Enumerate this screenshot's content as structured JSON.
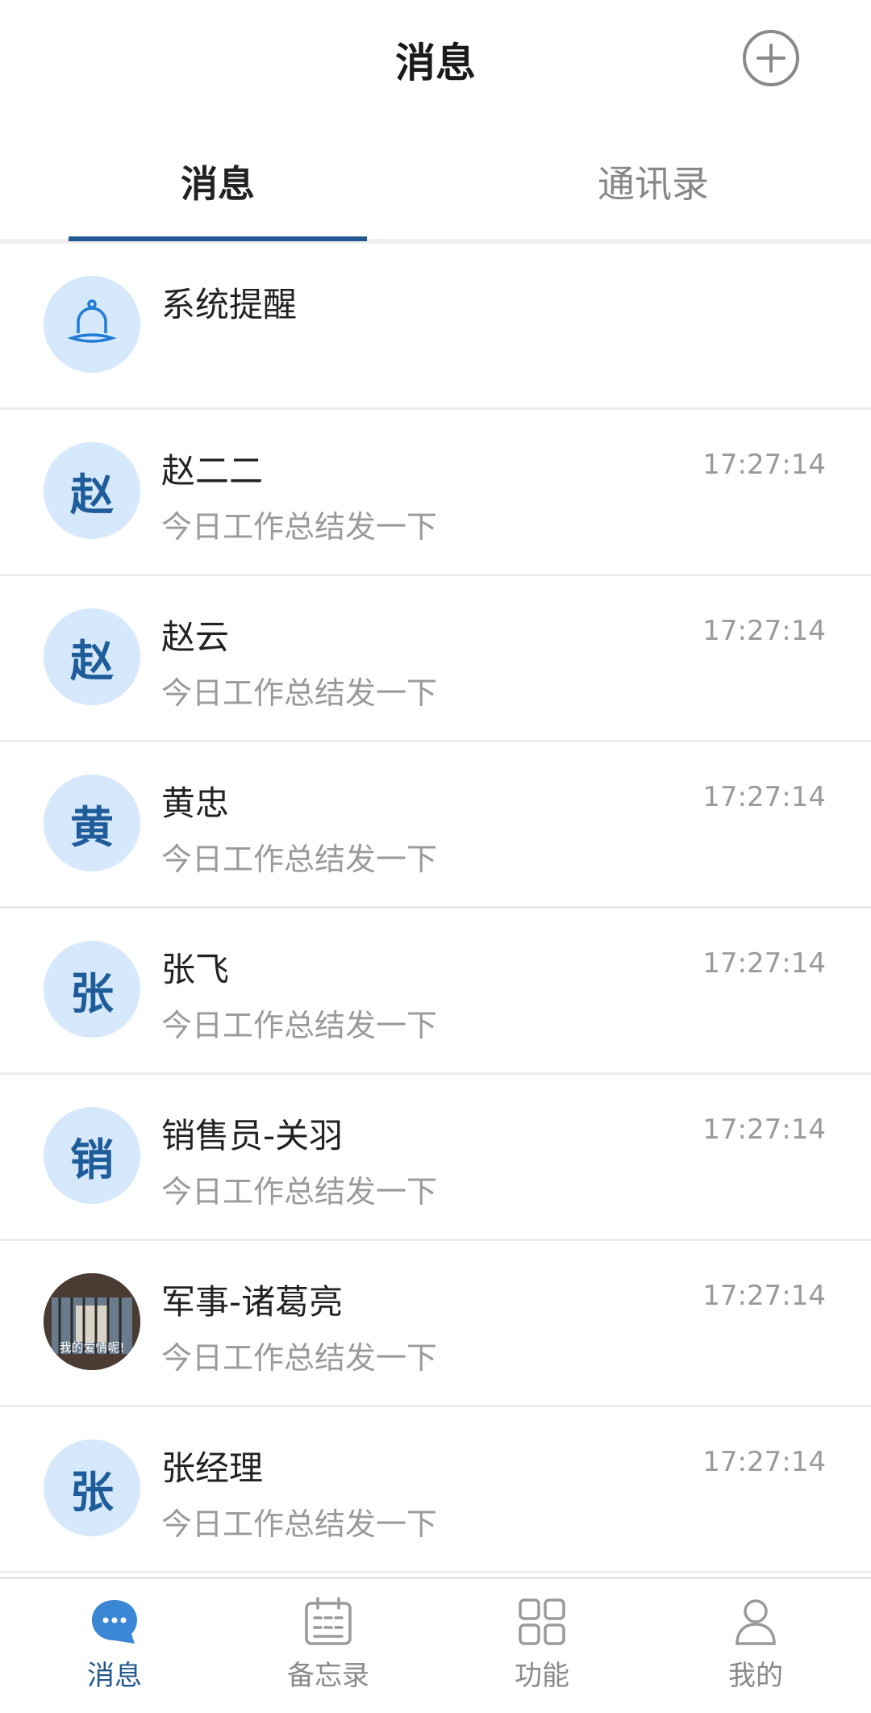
{
  "header": {
    "title": "消息",
    "add_icon": "plus-circle-icon"
  },
  "tabs": [
    {
      "label": "消息",
      "active": true
    },
    {
      "label": "通讯录",
      "active": false
    }
  ],
  "messages": [
    {
      "name": "系统提醒",
      "preview": "",
      "time": "",
      "avatar": "bell-icon"
    },
    {
      "name": "赵二二",
      "preview": "今日工作总结发一下",
      "time": "17:27:14",
      "avatar": "赵"
    },
    {
      "name": "赵云",
      "preview": "今日工作总结发一下",
      "time": "17:27:14",
      "avatar": "赵"
    },
    {
      "name": "黄忠",
      "preview": "今日工作总结发一下",
      "time": "17:27:14",
      "avatar": "黄"
    },
    {
      "name": "张飞",
      "preview": "今日工作总结发一下",
      "time": "17:27:14",
      "avatar": "张"
    },
    {
      "name": "销售员-关羽",
      "preview": "今日工作总结发一下",
      "time": "17:27:14",
      "avatar": "销"
    },
    {
      "name": "军事-诸葛亮",
      "preview": "今日工作总结发一下",
      "time": "17:27:14",
      "avatar": "photo",
      "avatar_caption": "我的爱情呢!"
    },
    {
      "name": "张经理",
      "preview": "今日工作总结发一下",
      "time": "17:27:14",
      "avatar": "张"
    }
  ],
  "bottom_nav": [
    {
      "label": "消息",
      "icon": "chat-bubble-icon",
      "active": true
    },
    {
      "label": "备忘录",
      "icon": "calendar-icon",
      "active": false
    },
    {
      "label": "功能",
      "icon": "grid-icon",
      "active": false
    },
    {
      "label": "我的",
      "icon": "person-icon",
      "active": false
    }
  ],
  "colors": {
    "accent": "#22588f",
    "avatar_bg": "#d6e8fb",
    "muted": "#9a9a9a"
  }
}
